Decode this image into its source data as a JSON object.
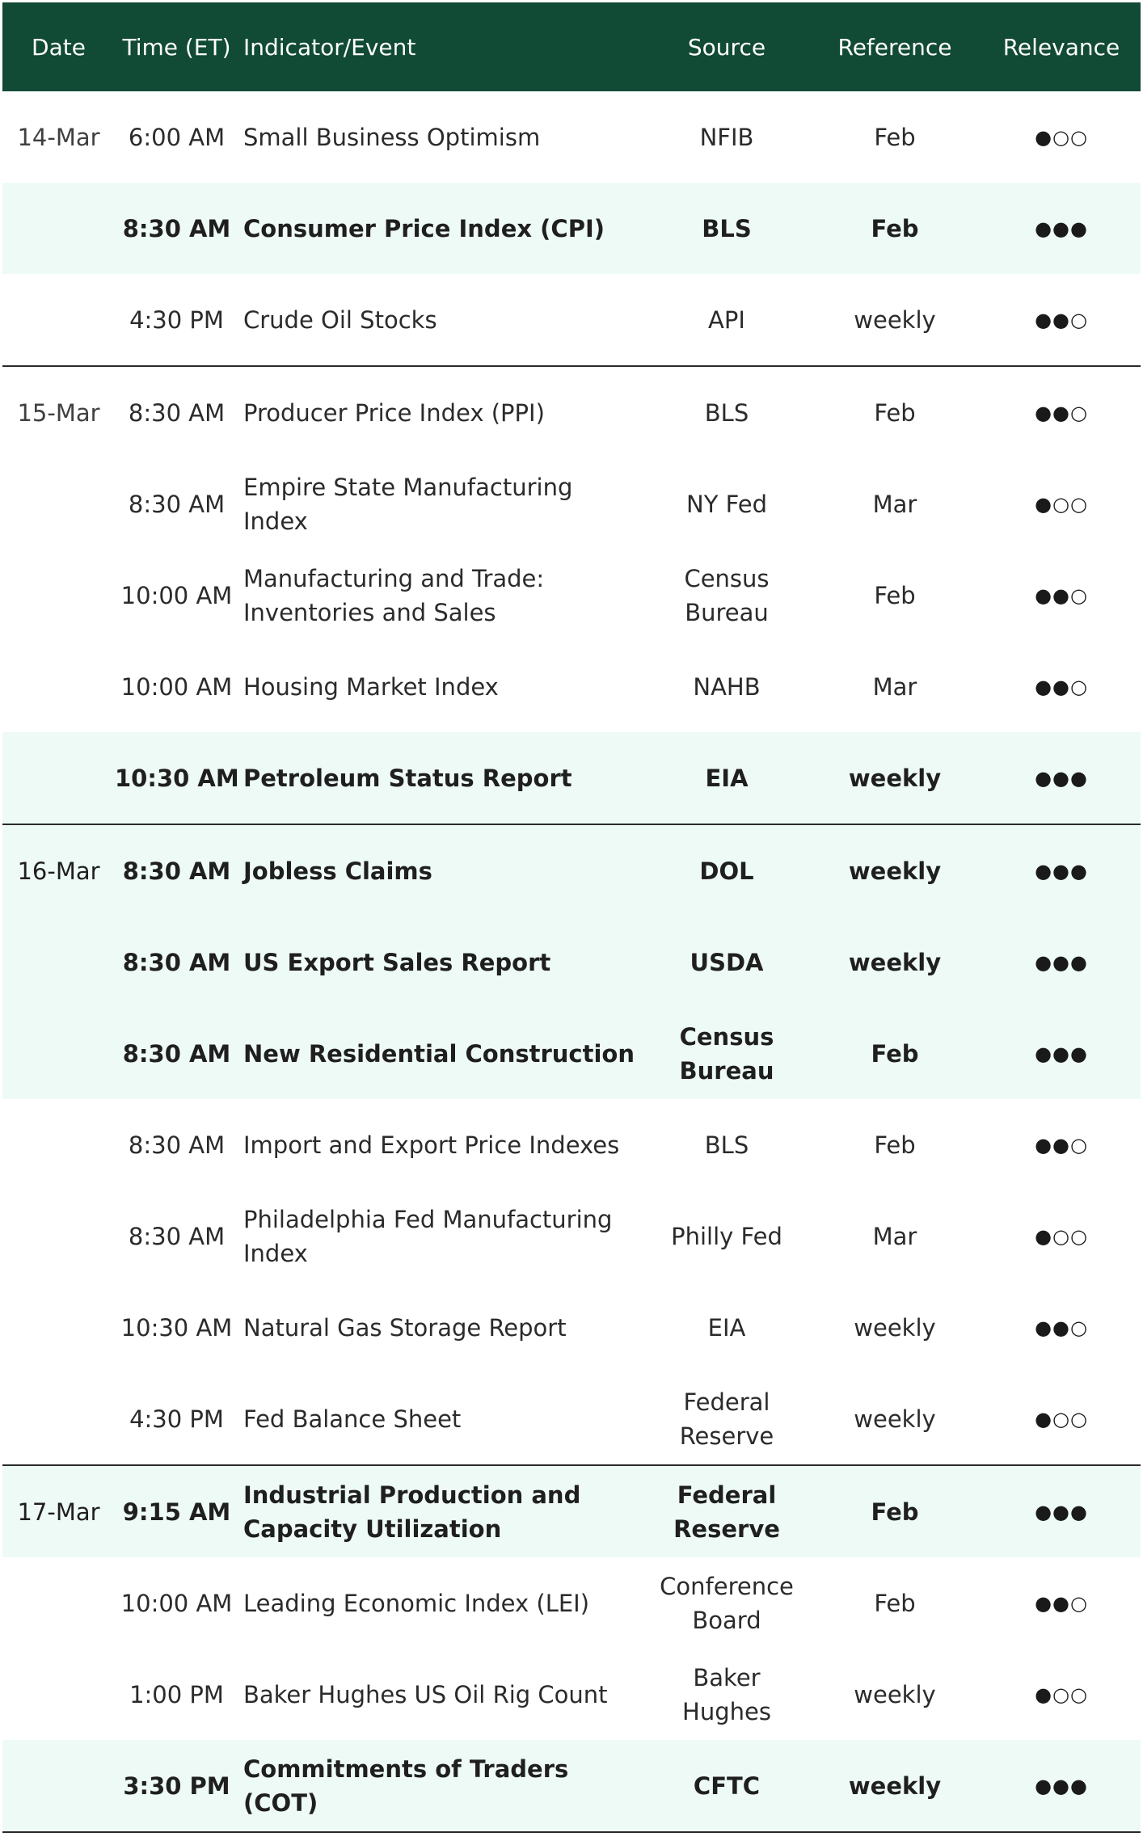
{
  "headers": {
    "date": "Date",
    "time": "Time (ET)",
    "indicator": "Indicator/Event",
    "source": "Source",
    "reference": "Reference",
    "relevance": "Relevance"
  },
  "colors": {
    "header_bg": "#114a35",
    "highlight_bg": "#eefaf6",
    "separator": "#2a2a2a"
  },
  "relevance_symbols": {
    "filled": "●",
    "empty": "○"
  },
  "rows": [
    {
      "date": "14-Mar",
      "time": "6:00 AM",
      "indicator": "Small Business Optimism",
      "source": "NFIB",
      "reference": "Feb",
      "relevance": 1,
      "highlight": false,
      "bold": false,
      "group_end": false
    },
    {
      "date": "",
      "time": "8:30 AM",
      "indicator": "Consumer Price Index (CPI)",
      "source": "BLS",
      "reference": "Feb",
      "relevance": 3,
      "highlight": true,
      "bold": true,
      "group_end": false
    },
    {
      "date": "",
      "time": "4:30 PM",
      "indicator": "Crude Oil Stocks",
      "source": "API",
      "reference": "weekly",
      "relevance": 2,
      "highlight": false,
      "bold": false,
      "group_end": true
    },
    {
      "date": "15-Mar",
      "time": "8:30 AM",
      "indicator": "Producer Price Index (PPI)",
      "source": "BLS",
      "reference": "Feb",
      "relevance": 2,
      "highlight": false,
      "bold": false,
      "group_end": false
    },
    {
      "date": "",
      "time": "8:30 AM",
      "indicator": "Empire State Manufacturing Index",
      "source": "NY Fed",
      "reference": "Mar",
      "relevance": 1,
      "highlight": false,
      "bold": false,
      "group_end": false
    },
    {
      "date": "",
      "time": "10:00 AM",
      "indicator": "Manufacturing and Trade: Inventories and Sales",
      "source": "Census Bureau",
      "reference": "Feb",
      "relevance": 2,
      "highlight": false,
      "bold": false,
      "group_end": false
    },
    {
      "date": "",
      "time": "10:00 AM",
      "indicator": "Housing Market Index",
      "source": "NAHB",
      "reference": "Mar",
      "relevance": 2,
      "highlight": false,
      "bold": false,
      "group_end": false
    },
    {
      "date": "",
      "time": "10:30 AM",
      "indicator": "Petroleum Status Report",
      "source": "EIA",
      "reference": "weekly",
      "relevance": 3,
      "highlight": true,
      "bold": true,
      "group_end": true
    },
    {
      "date": "16-Mar",
      "time": "8:30 AM",
      "indicator": "Jobless Claims",
      "source": "DOL",
      "reference": "weekly",
      "relevance": 3,
      "highlight": true,
      "bold": true,
      "group_end": false
    },
    {
      "date": "",
      "time": "8:30 AM",
      "indicator": "US Export Sales Report",
      "source": "USDA",
      "reference": "weekly",
      "relevance": 3,
      "highlight": true,
      "bold": true,
      "group_end": false
    },
    {
      "date": "",
      "time": "8:30 AM",
      "indicator": "New Residential Construction",
      "source": "Census Bureau",
      "reference": "Feb",
      "relevance": 3,
      "highlight": true,
      "bold": true,
      "group_end": false
    },
    {
      "date": "",
      "time": "8:30 AM",
      "indicator": "Import and Export Price Indexes",
      "source": "BLS",
      "reference": "Feb",
      "relevance": 2,
      "highlight": false,
      "bold": false,
      "group_end": false
    },
    {
      "date": "",
      "time": "8:30 AM",
      "indicator": "Philadelphia Fed Manufacturing Index",
      "source": "Philly Fed",
      "reference": "Mar",
      "relevance": 1,
      "highlight": false,
      "bold": false,
      "group_end": false
    },
    {
      "date": "",
      "time": "10:30 AM",
      "indicator": "Natural Gas Storage Report",
      "source": "EIA",
      "reference": "weekly",
      "relevance": 2,
      "highlight": false,
      "bold": false,
      "group_end": false
    },
    {
      "date": "",
      "time": "4:30 PM",
      "indicator": "Fed Balance Sheet",
      "source": "Federal Reserve",
      "reference": "weekly",
      "relevance": 1,
      "highlight": false,
      "bold": false,
      "group_end": true
    },
    {
      "date": "17-Mar",
      "time": "9:15 AM",
      "indicator": "Industrial Production and Capacity Utilization",
      "source": "Federal Reserve",
      "reference": "Feb",
      "relevance": 3,
      "highlight": true,
      "bold": true,
      "group_end": false
    },
    {
      "date": "",
      "time": "10:00 AM",
      "indicator": "Leading Economic Index (LEI)",
      "source": "Conference Board",
      "reference": "Feb",
      "relevance": 2,
      "highlight": false,
      "bold": false,
      "group_end": false
    },
    {
      "date": "",
      "time": "1:00 PM",
      "indicator": "Baker Hughes US Oil Rig Count",
      "source": "Baker Hughes",
      "reference": "weekly",
      "relevance": 1,
      "highlight": false,
      "bold": false,
      "group_end": false
    },
    {
      "date": "",
      "time": "3:30 PM",
      "indicator": "Commitments of Traders (COT)",
      "source": "CFTC",
      "reference": "weekly",
      "relevance": 3,
      "highlight": true,
      "bold": true,
      "group_end": true
    }
  ]
}
